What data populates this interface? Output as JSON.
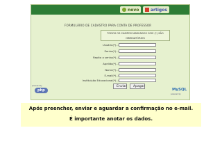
{
  "header": {
    "logo_novo": "novo",
    "logo_artigos": "artigos"
  },
  "form": {
    "title": "FORMULÁRIO DE CADASTRO PARA CONTA DE PROFESSOR",
    "notice_line1": "TODOS OS CAMPOS MARCADOS COM (*) SÃO",
    "notice_line2": "OBRIGATÓRIOS",
    "fields": [
      {
        "label": "Usuário(*)..:",
        "value": ""
      },
      {
        "label": "Senha(*)..:",
        "value": ""
      },
      {
        "label": "Repita a senha(*)..:",
        "value": ""
      },
      {
        "label": "Apelido(*)..:",
        "value": ""
      },
      {
        "label": "Nome(*)..:",
        "value": ""
      },
      {
        "label": "E-mail(*)..:",
        "value": ""
      },
      {
        "label": "Instituição Educacional(*)..:",
        "value": ""
      }
    ],
    "submit_label": "Enviar",
    "reset_label": "Apagar"
  },
  "badges": {
    "php_caption": "powered by",
    "php_label": "php",
    "mysql_label": "MySQL",
    "mysql_caption": "powered by"
  },
  "banner": {
    "line1": "Após preencher, enviar e aguardar a confirmação no e-mail.",
    "line2": "É importante anotar os dados."
  },
  "colors": {
    "topbar": "#2e7d36",
    "form_bg": "#e6f1cf",
    "banner_bg": "#ffffcc"
  }
}
